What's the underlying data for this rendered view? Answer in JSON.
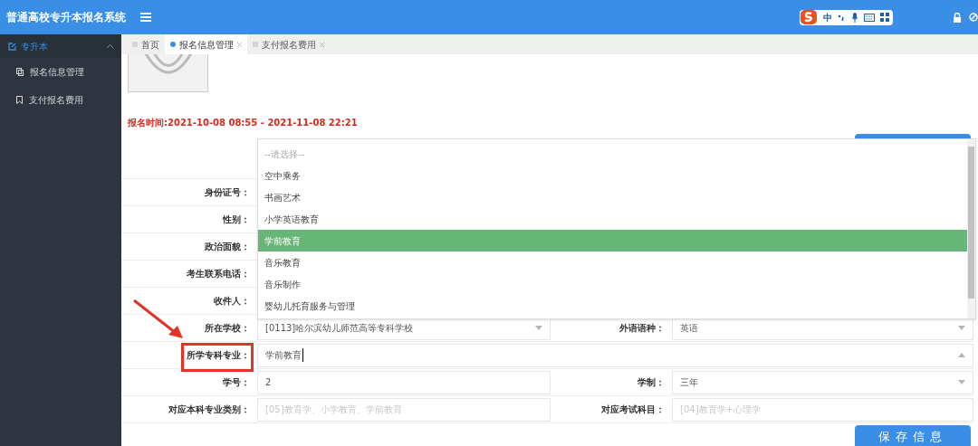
{
  "header": {
    "title": "普通高校专升本报名系统",
    "ime_label": "中"
  },
  "sidebar": {
    "group": {
      "label": "专升本",
      "expanded": true
    },
    "items": [
      {
        "label": "报名信息管理",
        "kind": "copy"
      },
      {
        "label": "支付报名费用",
        "kind": "bookmark"
      }
    ]
  },
  "tabs": [
    {
      "label": "首页",
      "selected": false,
      "closable": false
    },
    {
      "label": "报名信息管理",
      "selected": true,
      "closable": true
    },
    {
      "label": "支付报名费用",
      "selected": false,
      "closable": true
    }
  ],
  "period": "报名时间:2021-10-08 08:55 - 2021-11-08 22:21",
  "save_button": "保存信息",
  "form_rows": [
    {
      "fields": [
        {
          "label": "身份证号：",
          "kind": "text"
        }
      ]
    },
    {
      "fields": [
        {
          "label": "性别：",
          "kind": "text"
        }
      ]
    },
    {
      "fields": [
        {
          "label": "政治面貌：",
          "kind": "text"
        }
      ]
    },
    {
      "fields": [
        {
          "label": "考生联系电话：",
          "kind": "text"
        }
      ]
    },
    {
      "fields": [
        {
          "label": "收件人：",
          "kind": "text"
        }
      ]
    },
    {
      "fields": [
        {
          "label": "所在学校：",
          "kind": "select",
          "value": "[0113]哈尔滨幼儿师范高等专科学校"
        },
        {
          "label": "外语语种：",
          "kind": "select",
          "value": "英语"
        }
      ]
    },
    {
      "fields": [
        {
          "label": "所学专科专业：",
          "kind": "combo",
          "value": "学前教育",
          "highlighted": true
        }
      ]
    },
    {
      "fields": [
        {
          "label": "学号：",
          "kind": "text",
          "value": "2"
        },
        {
          "label": "学制：",
          "kind": "select",
          "value": "三年"
        }
      ]
    },
    {
      "fields": [
        {
          "label": "对应本科专业类别：",
          "kind": "text",
          "placeholder": "[05]教育学、小学教育、学前教育"
        },
        {
          "label": "对应考试科目：",
          "kind": "text",
          "placeholder": "[04]教育学+心理学"
        }
      ]
    }
  ],
  "dropdown": [
    {
      "label": "--请选择--",
      "selected": false,
      "kind": "hint"
    },
    {
      "label": "空中乘务",
      "selected": false,
      "kind": "option"
    },
    {
      "label": "书画艺术",
      "selected": false,
      "kind": "option"
    },
    {
      "label": "小学英语教育",
      "selected": false,
      "kind": "option"
    },
    {
      "label": "学前教育",
      "selected": true,
      "kind": "option"
    },
    {
      "label": "音乐教育",
      "selected": false,
      "kind": "option"
    },
    {
      "label": "音乐制作",
      "selected": false,
      "kind": "option"
    },
    {
      "label": "婴幼儿托育服务与管理",
      "selected": false,
      "kind": "option"
    }
  ]
}
